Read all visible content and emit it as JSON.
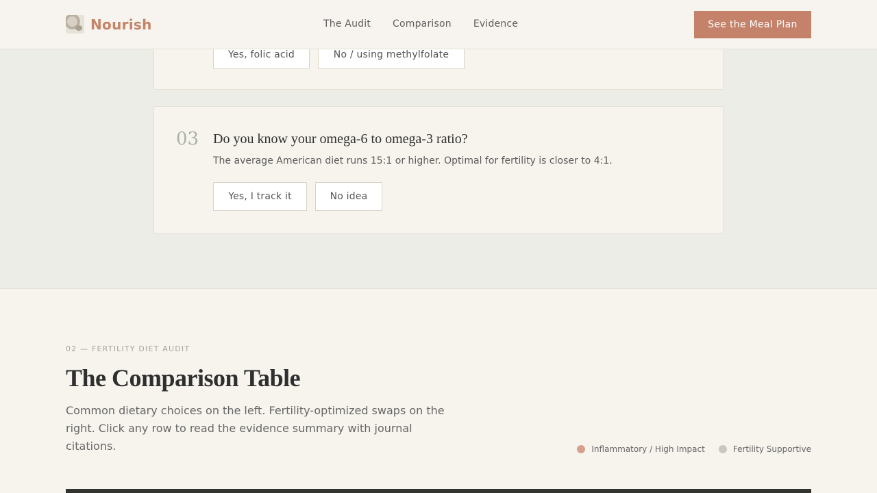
{
  "header": {
    "brand": "Nourish",
    "nav": [
      "The Audit",
      "Comparison",
      "Evidence"
    ],
    "cta": "See the Meal Plan"
  },
  "audit": {
    "previous_question": {
      "options": [
        "Yes, folic acid",
        "No / using methylfolate"
      ]
    },
    "question": {
      "number": "03",
      "title": "Do you know your omega-6 to omega-3 ratio?",
      "description": "The average American diet runs 15:1 or higher. Optimal for fertility is closer to 4:1.",
      "options": [
        "Yes, I track it",
        "No idea"
      ]
    }
  },
  "comparison": {
    "eyebrow": "02 — FERTILITY DIET AUDIT",
    "title": "The Comparison Table",
    "description": "Common dietary choices on the left. Fertility-optimized swaps on the right. Click any row to read the evidence summary with journal citations.",
    "legend": [
      {
        "label": "Inflammatory / High Impact",
        "color": "#d7a08c"
      },
      {
        "label": "Fertility Supportive",
        "color": "#c8c8c0"
      }
    ]
  }
}
